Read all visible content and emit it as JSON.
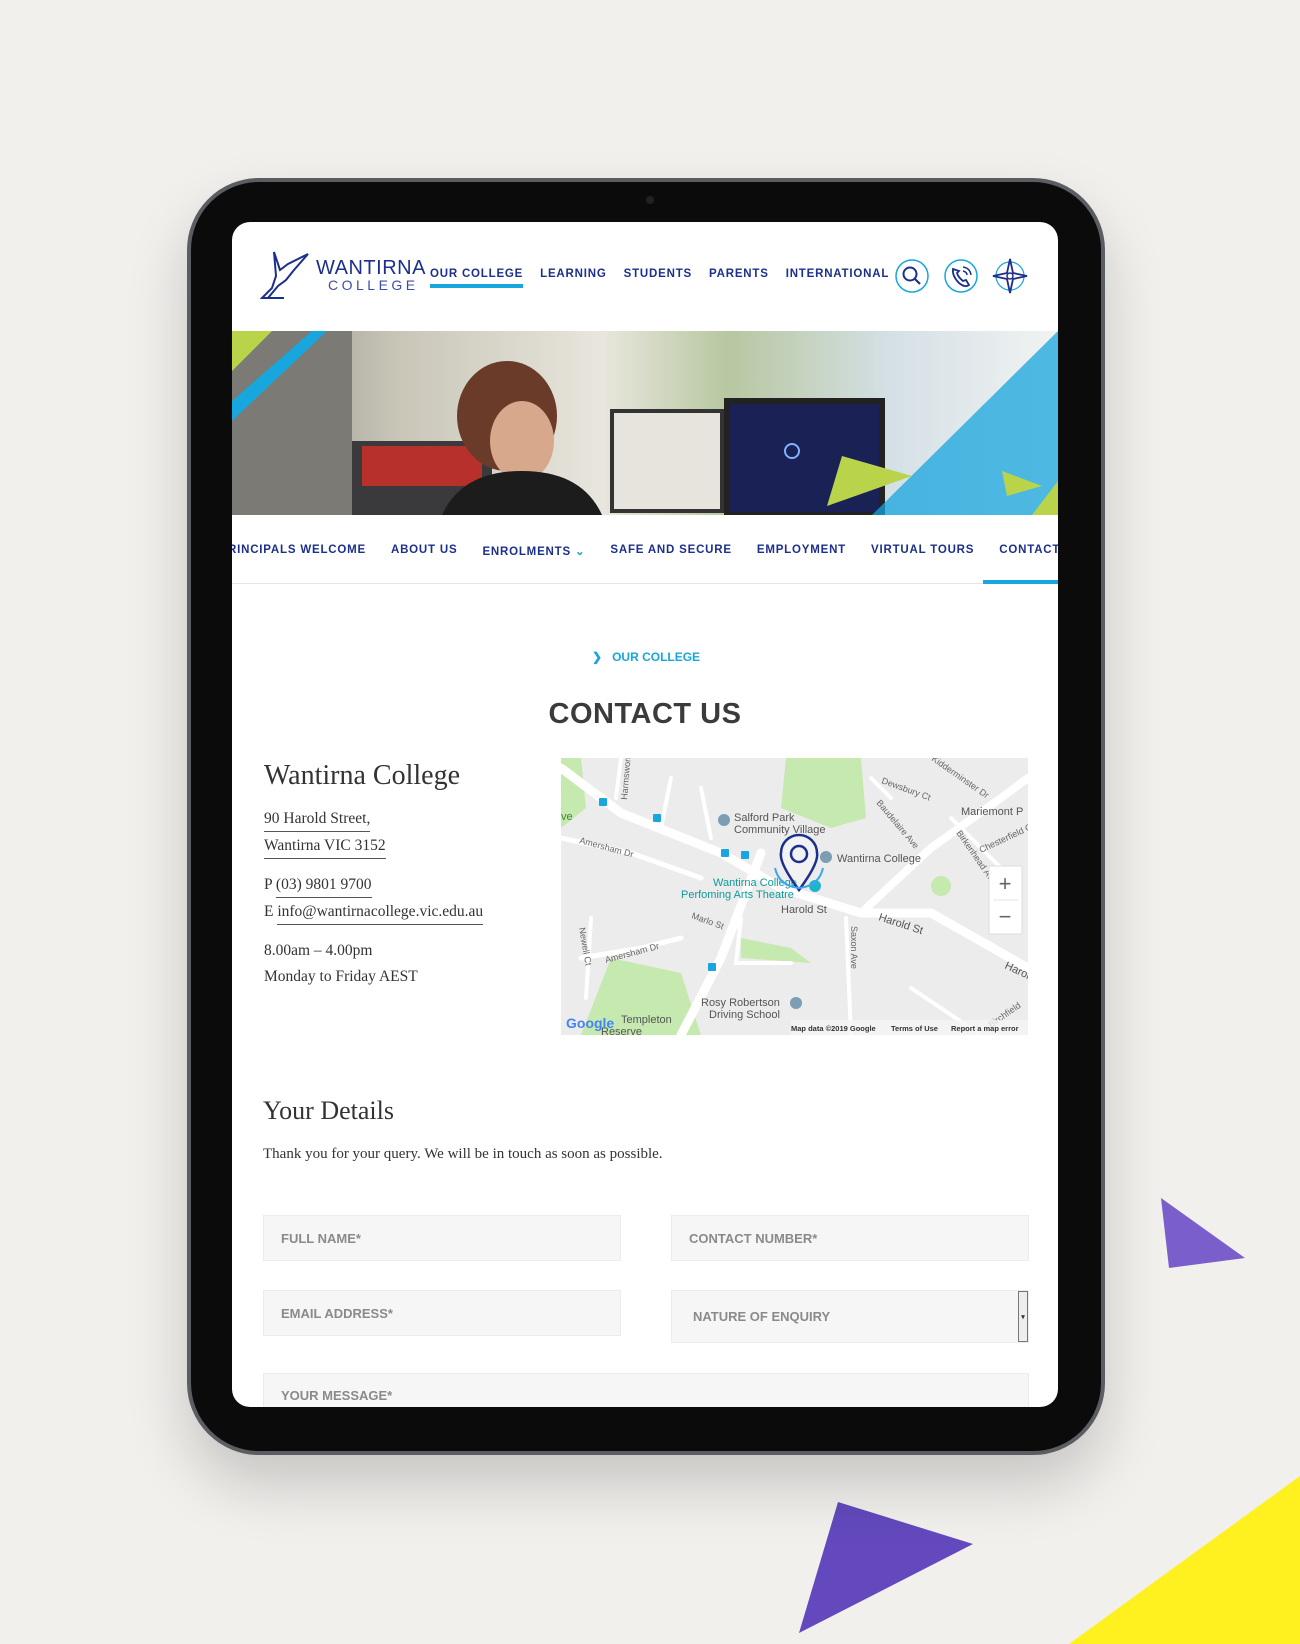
{
  "colors": {
    "brand_navy": "#1c2f8c",
    "accent_blue": "#17a6dd",
    "accent_purple": "#6a4fc1",
    "accent_yellow": "#fff01f",
    "lime": "#b9d44a"
  },
  "header": {
    "logo": {
      "line1": "WANTIRNA",
      "line2": "COLLEGE"
    },
    "nav": [
      {
        "label": "OUR COLLEGE",
        "active": true
      },
      {
        "label": "LEARNING"
      },
      {
        "label": "STUDENTS"
      },
      {
        "label": "PARENTS"
      },
      {
        "label": "INTERNATIONAL"
      }
    ],
    "icons": [
      "search-icon",
      "phone-icon",
      "compass-icon"
    ]
  },
  "subnav": {
    "items": [
      {
        "label": "RINCIPALS WELCOME"
      },
      {
        "label": "ABOUT US"
      },
      {
        "label": "ENROLMENTS",
        "dropdown": true
      },
      {
        "label": "SAFE AND SECURE"
      },
      {
        "label": "EMPLOYMENT"
      },
      {
        "label": "VIRTUAL TOURS"
      },
      {
        "label": "CONTACT U",
        "active": true
      }
    ]
  },
  "breadcrumb": {
    "label": "OUR COLLEGE"
  },
  "page_title": "CONTACT US",
  "contact": {
    "name": "Wantirna College",
    "address1": "90 Harold Street,",
    "address2": "Wantirna VIC 3152",
    "phone_prefix": "P",
    "phone": "(03) 9801 9700",
    "email_prefix": "E",
    "email": "info@wantirnacollege.vic.edu.au",
    "hours": "8.00am – 4.00pm",
    "days": "Monday to Friday AEST"
  },
  "map": {
    "labels": {
      "salford1": "Salford Park",
      "salford2": "Community Village",
      "college": "Wantirna College",
      "theatre1": "Wantirna College",
      "theatre2": "Perfoming Arts Theatre",
      "harold1": "Harold St",
      "harold2": "Harold St",
      "harold3": "Harol",
      "mariemont": "Mariemont P",
      "rosy1": "Rosy Robertson",
      "rosy2": "Driving School",
      "amersham1": "Amersham Dr",
      "amersham2": "Amersham Dr",
      "marlo": "Marlo St",
      "saxon": "Saxon Ave",
      "newell": "Newell Ct",
      "dewsbury": "Dewsbury Ct",
      "baudelaire": "Baudelaire Ave",
      "birkenhead": "Birkenhead Ave",
      "chesterfield": "Chesterfield C",
      "harmsworth": "Harmswort",
      "kidderminster": "Kidderminster Dr",
      "templeton1": "Templeton",
      "templeton2": "Reserve",
      "ve": "ve",
      "birchfield": "Birchfield"
    },
    "google": "Google",
    "attribution": "Map data ©2019 Google",
    "terms": "Terms of Use",
    "report": "Report a map error",
    "zoom_in": "+",
    "zoom_out": "−"
  },
  "form": {
    "heading": "Your Details",
    "intro": "Thank you for your query. We will be in touch as soon as possible.",
    "full_name_placeholder": "FULL NAME*",
    "contact_number_placeholder": "CONTACT NUMBER*",
    "email_placeholder": "EMAIL ADDRESS*",
    "enquiry_selected": "NATURE OF ENQUIRY",
    "message_placeholder": "YOUR MESSAGE*"
  }
}
